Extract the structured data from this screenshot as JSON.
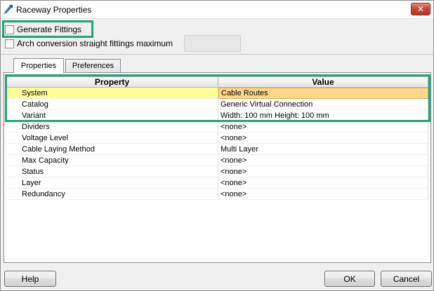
{
  "window": {
    "title": "Raceway Properties",
    "close_glyph": "✕"
  },
  "options": {
    "generate_fittings_label": "Generate Fittings",
    "generate_fittings_checked": false,
    "arch_conversion_label": "Arch conversion straight fittings maximum",
    "arch_conversion_checked": false,
    "arch_conversion_value": ""
  },
  "tabs": [
    {
      "label": "Properties",
      "active": true
    },
    {
      "label": "Preferences",
      "active": false
    }
  ],
  "grid": {
    "headers": {
      "property": "Property",
      "value": "Value"
    },
    "rows": [
      {
        "property": "System",
        "value": "Cable Routes",
        "selected": true
      },
      {
        "property": "Catalog",
        "value": "Generic Virtual Connection"
      },
      {
        "property": "Variant",
        "value": "Width: 100 mm  Height: 100 mm"
      },
      {
        "property": "Dividers",
        "value": "<none>"
      },
      {
        "property": "Voltage Level",
        "value": "<none>"
      },
      {
        "property": "Cable Laying Method",
        "value": "Multi Layer"
      },
      {
        "property": "Max Capacity",
        "value": "<none>"
      },
      {
        "property": "Status",
        "value": "<none>"
      },
      {
        "property": "Layer",
        "value": "<none>"
      },
      {
        "property": "Redundancy",
        "value": "<none>"
      }
    ]
  },
  "buttons": {
    "help": "Help",
    "ok": "OK",
    "cancel": "Cancel"
  },
  "colors": {
    "highlight_outline": "#1fa67a",
    "selected_property_bg": "#ffff99",
    "selected_value_bg": "#ffd98a"
  }
}
